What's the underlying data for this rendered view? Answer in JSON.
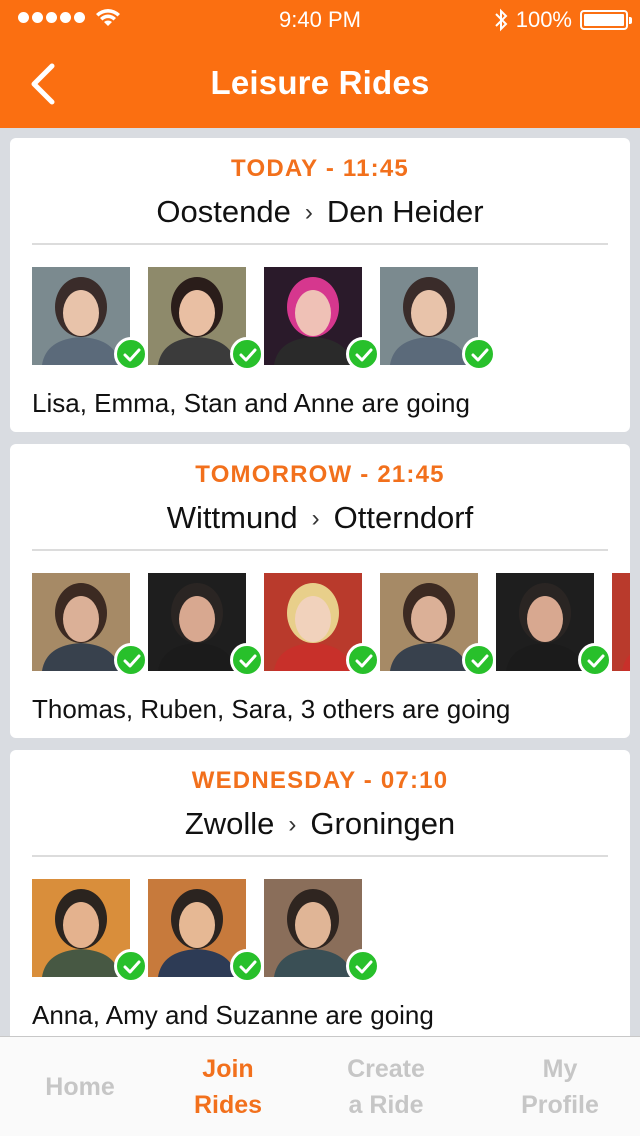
{
  "status_bar": {
    "time": "9:40 PM",
    "battery": "100%"
  },
  "header": {
    "title": "Leisure Rides",
    "back_icon": "chevron-left-icon"
  },
  "colors": {
    "accent": "#fb6f11",
    "date_text": "#f2701c",
    "check": "#28c02b",
    "inactive_tab": "#c6c6c6"
  },
  "rides": [
    {
      "when": "TODAY - 11:45",
      "from": "Oostende",
      "to": "Den Heider",
      "going": "Lisa, Emma, Stan and Anne are going",
      "attendees": [
        "Lisa",
        "Emma",
        "Stan",
        "Anne"
      ]
    },
    {
      "when": "TOMORROW - 21:45",
      "from": "Wittmund",
      "to": "Otterndorf",
      "going": "Thomas, Ruben, Sara, 3 others are going",
      "attendees": [
        "Thomas",
        "Ruben",
        "Sara",
        "",
        "",
        ""
      ]
    },
    {
      "when": "WEDNESDAY - 07:10",
      "from": "Zwolle",
      "to": "Groningen",
      "going": "Anna, Amy and Suzanne are going",
      "attendees": [
        "Anna",
        "Amy",
        "Suzanne"
      ]
    }
  ],
  "route_separator": "›",
  "tabs": [
    {
      "line1": "Home",
      "line2": "",
      "active": false
    },
    {
      "line1": "Join",
      "line2": "Rides",
      "active": true
    },
    {
      "line1": "Create",
      "line2": "a Ride",
      "active": false
    },
    {
      "line1": "My",
      "line2": "Profile",
      "active": false
    }
  ]
}
